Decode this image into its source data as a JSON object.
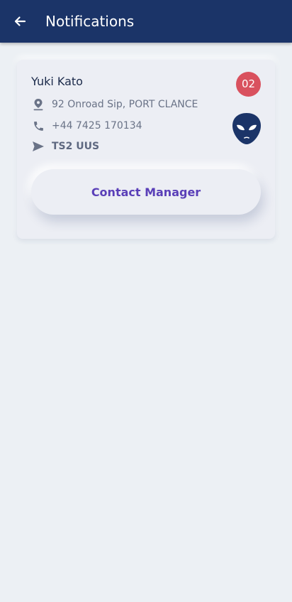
{
  "app_bar": {
    "title": "Notifications",
    "back_icon": "arrow-left-icon",
    "background_color": "#1b3468"
  },
  "card": {
    "name": "Yuki Kato",
    "badge": "02",
    "badge_color": "#d9515e",
    "avatar_icon": "alien-icon",
    "address": "92 Onroad Sip, PORT CLANCE",
    "phone": "+44 7425 170134",
    "code": "TS2 UUS",
    "contact_button_label": "Contact Manager",
    "accent_color": "#5a3fb8"
  }
}
